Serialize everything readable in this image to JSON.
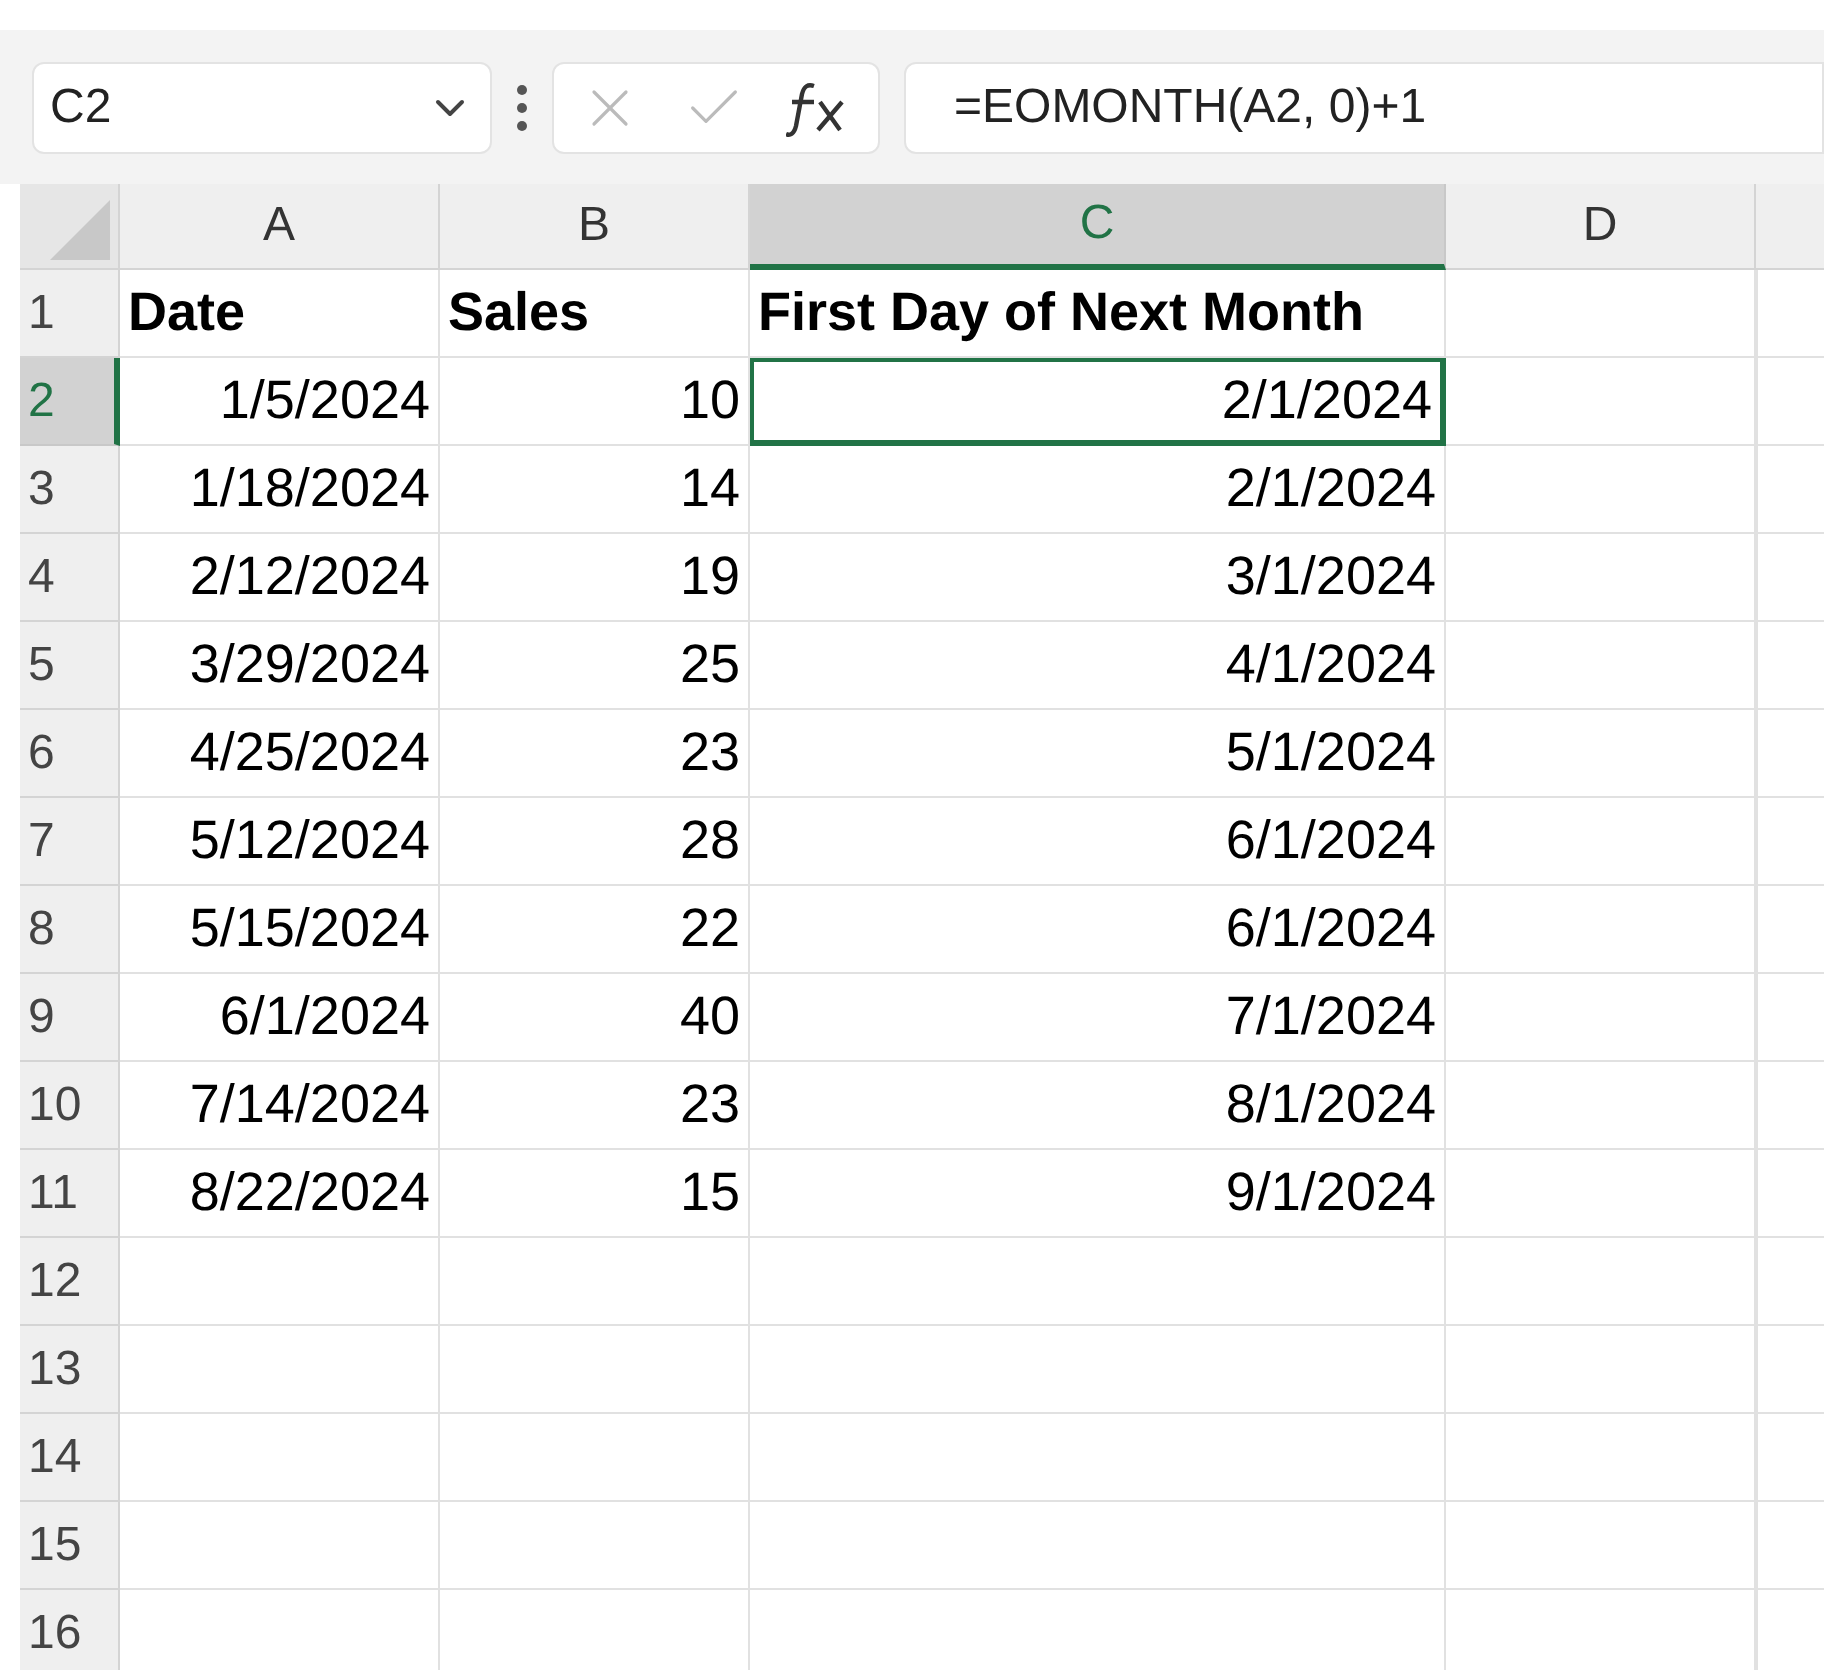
{
  "name_box": "C2",
  "formula": "=EOMONTH(A2, 0)+1",
  "columns": [
    {
      "label": "A",
      "selected": false
    },
    {
      "label": "B",
      "selected": false
    },
    {
      "label": "C",
      "selected": true
    },
    {
      "label": "D",
      "selected": false
    }
  ],
  "rows": [
    {
      "header": "1",
      "selected": false,
      "kind": "heading",
      "cells": [
        {
          "text": "Date",
          "selected": false
        },
        {
          "text": "Sales",
          "selected": false
        },
        {
          "text": "First Day of Next Month",
          "selected": false
        }
      ]
    },
    {
      "header": "2",
      "selected": true,
      "kind": "data",
      "cells": [
        {
          "text": "1/5/2024",
          "selected": false
        },
        {
          "text": "10",
          "selected": false
        },
        {
          "text": "2/1/2024",
          "selected": true
        }
      ]
    },
    {
      "header": "3",
      "selected": false,
      "kind": "data",
      "cells": [
        {
          "text": "1/18/2024",
          "selected": false
        },
        {
          "text": "14",
          "selected": false
        },
        {
          "text": "2/1/2024",
          "selected": false
        }
      ]
    },
    {
      "header": "4",
      "selected": false,
      "kind": "data",
      "cells": [
        {
          "text": "2/12/2024",
          "selected": false
        },
        {
          "text": "19",
          "selected": false
        },
        {
          "text": "3/1/2024",
          "selected": false
        }
      ]
    },
    {
      "header": "5",
      "selected": false,
      "kind": "data",
      "cells": [
        {
          "text": "3/29/2024",
          "selected": false
        },
        {
          "text": "25",
          "selected": false
        },
        {
          "text": "4/1/2024",
          "selected": false
        }
      ]
    },
    {
      "header": "6",
      "selected": false,
      "kind": "data",
      "cells": [
        {
          "text": "4/25/2024",
          "selected": false
        },
        {
          "text": "23",
          "selected": false
        },
        {
          "text": "5/1/2024",
          "selected": false
        }
      ]
    },
    {
      "header": "7",
      "selected": false,
      "kind": "data",
      "cells": [
        {
          "text": "5/12/2024",
          "selected": false
        },
        {
          "text": "28",
          "selected": false
        },
        {
          "text": "6/1/2024",
          "selected": false
        }
      ]
    },
    {
      "header": "8",
      "selected": false,
      "kind": "data",
      "cells": [
        {
          "text": "5/15/2024",
          "selected": false
        },
        {
          "text": "22",
          "selected": false
        },
        {
          "text": "6/1/2024",
          "selected": false
        }
      ]
    },
    {
      "header": "9",
      "selected": false,
      "kind": "data",
      "cells": [
        {
          "text": "6/1/2024",
          "selected": false
        },
        {
          "text": "40",
          "selected": false
        },
        {
          "text": "7/1/2024",
          "selected": false
        }
      ]
    },
    {
      "header": "10",
      "selected": false,
      "kind": "data",
      "cells": [
        {
          "text": "7/14/2024",
          "selected": false
        },
        {
          "text": "23",
          "selected": false
        },
        {
          "text": "8/1/2024",
          "selected": false
        }
      ]
    },
    {
      "header": "11",
      "selected": false,
      "kind": "data",
      "cells": [
        {
          "text": "8/22/2024",
          "selected": false
        },
        {
          "text": "15",
          "selected": false
        },
        {
          "text": "9/1/2024",
          "selected": false
        }
      ]
    },
    {
      "header": "12",
      "selected": false,
      "kind": "data"
    },
    {
      "header": "13",
      "selected": false,
      "kind": "data"
    },
    {
      "header": "14",
      "selected": false,
      "kind": "data"
    },
    {
      "header": "15",
      "selected": false,
      "kind": "data"
    },
    {
      "header": "16",
      "selected": false,
      "kind": "data"
    }
  ]
}
